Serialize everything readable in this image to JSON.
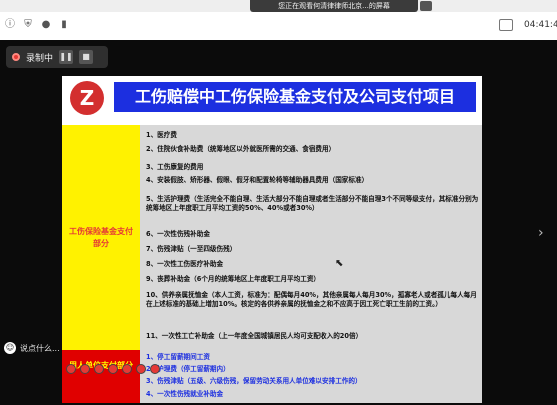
{
  "browser": {
    "share_banner": "您正在观看何清律律师北京...的屏幕",
    "clock": "04:41:4",
    "icons": [
      "info-icon",
      "shield-icon",
      "wechat-icon",
      "signal-icon"
    ]
  },
  "recorder": {
    "label": "录制中",
    "pause": "❚❚",
    "stop": "■"
  },
  "slide": {
    "logo_glyph": "Z",
    "title": "工伤赔偿中工伤保险基金支付及公司支付项目",
    "left_top_label": "工伤保险基金支付部分",
    "left_bottom_label": "用人单位支付部分",
    "items_top": [
      "1、医疗费",
      "2、住院伙食补助费（统筹地区以外就医所需的交通、食宿费用）",
      "3、工伤康复的费用",
      "4、安装假肢、矫形器、假眼、假牙和配置轮椅等辅助器具费用（国家标准）",
      "5、生活护理费（生活完全不能自理、生活大部分不能自理或者生活部分不能自理3个不同等级支付，其标准分别为统筹地区上年度职工月平均工资的50%、40%或者30%）",
      "6、一次性伤残补助金",
      "7、伤残津贴（一至四级伤残）",
      "8、一次性工伤医疗补助金",
      "9、丧葬补助金（6个月的统筹地区上年度职工月平均工资）",
      "10、供养亲属抚恤金（本人工资，标准为：配偶每月40%，其他亲属每人每月30%，孤寡老人或者孤儿每人每月在上述标准的基础上增加10%。核定的各供养亲属的抚恤金之和不应高于因工死亡职工生前的工资。）",
      "11、一次性工亡补助金（上一年度全国城镇居民人均可支配收入的20倍）"
    ],
    "items_bottom": [
      "1、停工留薪期间工资",
      "2、护理费（停工留薪期内）",
      "3、伤残津贴（五级、六级伤残，保留劳动关系用人单位难以安排工作的）",
      "4、一次性伤残就业补助金"
    ]
  },
  "chat": {
    "label": "说点什么..."
  },
  "colors": {
    "title_blue": "#1c2fe0",
    "yellow": "#fff200",
    "red": "#e00000",
    "recording_red": "#e53935"
  }
}
